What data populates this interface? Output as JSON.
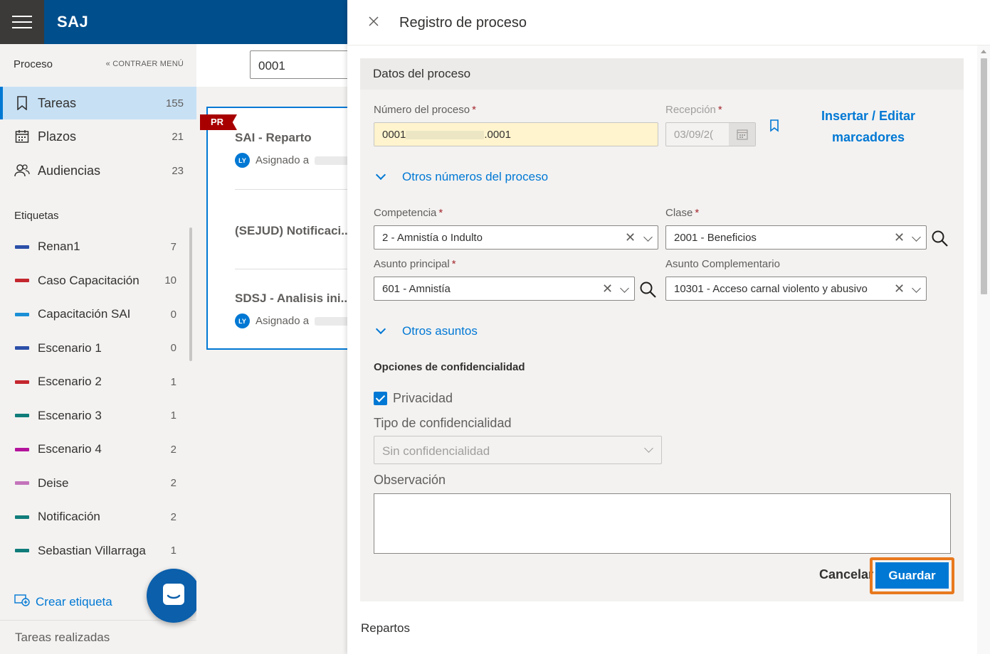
{
  "app": {
    "brand": "SAJ"
  },
  "sidebar": {
    "header": "Proceso",
    "collapse_label": "CONTRAER MENÚ",
    "nav": [
      {
        "label": "Tareas",
        "count": "155"
      },
      {
        "label": "Plazos",
        "count": "21"
      },
      {
        "label": "Audiencias",
        "count": "23"
      }
    ],
    "tags_title": "Etiquetas",
    "tags": [
      {
        "label": "Renan1",
        "count": "7",
        "color": "#2b4fa8"
      },
      {
        "label": "Caso Capacitación",
        "count": "10",
        "color": "#c4262e"
      },
      {
        "label": "Capacitación SAI",
        "count": "0",
        "color": "#1a8fd6"
      },
      {
        "label": "Escenario 1",
        "count": "0",
        "color": "#2b4fa8"
      },
      {
        "label": "Escenario 2",
        "count": "1",
        "color": "#c4262e"
      },
      {
        "label": "Escenario 3",
        "count": "1",
        "color": "#107c7a"
      },
      {
        "label": "Escenario 4",
        "count": "2",
        "color": "#b4139c"
      },
      {
        "label": "Deise",
        "count": "2",
        "color": "#c373bb"
      },
      {
        "label": "Notificación",
        "count": "2",
        "color": "#107c7a"
      },
      {
        "label": "Sebastian Villarraga",
        "count": "1",
        "color": "#107c7a"
      }
    ],
    "create_tag": "Crear etiqueta",
    "footer": "Tareas realizadas"
  },
  "middle": {
    "search_value": "0001",
    "badge": "PR",
    "cards": [
      {
        "title": "SAI - Reparto",
        "assigned": "Asignado a",
        "avatar": "LY"
      },
      {
        "title": "(SEJUD) Notificaci...",
        "assigned": "",
        "avatar": ""
      },
      {
        "title": "SDSJ - Analisis ini...",
        "assigned": "Asignado a",
        "avatar": "LY"
      }
    ]
  },
  "drawer": {
    "title": "Registro de proceso",
    "section_title": "Datos del proceso",
    "numero_label": "Número del proceso",
    "numero_prefix": "0001",
    "numero_suffix": ".0001",
    "recepcion_label": "Recepción",
    "recepcion_value": "03/09/2(",
    "insert_link": "Insertar / Editar marcadores",
    "otros_numeros": "Otros números del proceso",
    "competencia_label": "Competencia",
    "competencia_value": "2 - Amnistía o Indulto",
    "clase_label": "Clase",
    "clase_value": "2001 - Beneficios",
    "asunto_label": "Asunto principal",
    "asunto_value": "601 - Amnistía",
    "asunto_comp_label": "Asunto Complementario",
    "asunto_comp_value": "10301 - Acceso carnal violento y abusivo",
    "otros_asuntos": "Otros asuntos",
    "conf_title": "Opciones de confidencialidad",
    "privacidad": "Privacidad",
    "tipo_conf_label": "Tipo de confidencialidad",
    "tipo_conf_value": "Sin confidencialidad",
    "observacion_label": "Observación",
    "cancel": "Cancelar",
    "save": "Guardar",
    "repartos": "Repartos"
  }
}
